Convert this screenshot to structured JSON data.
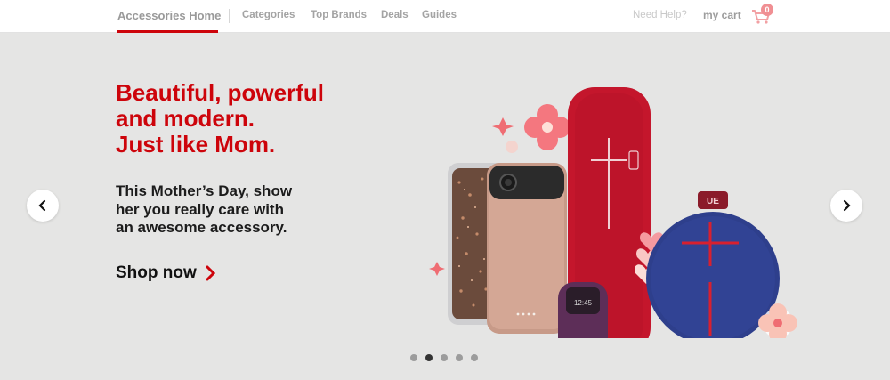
{
  "nav": {
    "home": "Accessories Home",
    "links": [
      "Categories",
      "Top Brands",
      "Deals",
      "Guides"
    ],
    "help": "Need Help?",
    "cart_label": "my cart",
    "cart_count": "0"
  },
  "hero": {
    "headline_lines": [
      "Beautiful, powerful",
      "and modern.",
      "Just like Mom."
    ],
    "subcopy_lines": [
      "This Mother’s Day, show",
      "her you really care with",
      "an awesome accessory."
    ],
    "cta": "Shop now",
    "watch_time": "12:45",
    "speaker_logo": "UE"
  },
  "carousel": {
    "slide_count": 5,
    "active_index": 1
  },
  "icons": {
    "prev": "chevron-left-icon",
    "next": "chevron-right-icon",
    "cart": "cart-icon",
    "cta": "chevron-right-icon"
  },
  "colors": {
    "brand_red": "#cd040b",
    "hero_bg": "#e5e5e4",
    "speaker_red": "#c4162c",
    "speaker_blue": "#2e3f8c"
  }
}
